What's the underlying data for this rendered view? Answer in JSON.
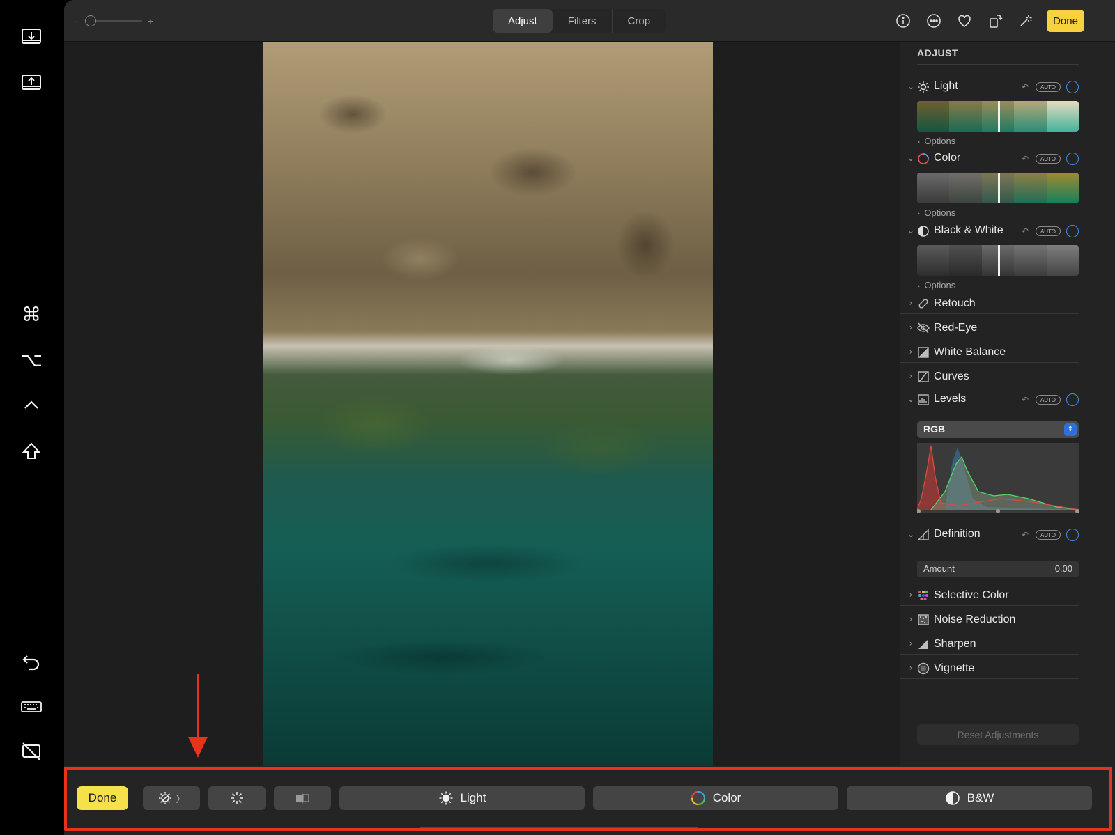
{
  "sidebar": {
    "items": [
      {
        "name": "screenshot-in-icon"
      },
      {
        "name": "screenshot-out-icon"
      },
      {
        "name": "command-key-icon",
        "glyph": "⌘"
      },
      {
        "name": "option-key-icon",
        "glyph": "⌥"
      },
      {
        "name": "control-key-icon",
        "glyph": "^"
      },
      {
        "name": "shift-key-icon",
        "glyph": "⇧"
      },
      {
        "name": "undo-icon"
      },
      {
        "name": "keyboard-icon"
      },
      {
        "name": "hide-screen-icon"
      }
    ]
  },
  "topbar": {
    "zoom": {
      "minus": "-",
      "plus": "+",
      "level": 0.0
    },
    "tabs": [
      {
        "label": "Adjust",
        "active": true
      },
      {
        "label": "Filters",
        "active": false
      },
      {
        "label": "Crop",
        "active": false
      }
    ],
    "icons": [
      "info-icon",
      "more-icon",
      "heart-icon",
      "rotate-icon",
      "magic-wand-icon"
    ],
    "done_label": "Done"
  },
  "panel": {
    "title": "ADJUST",
    "undo_glyph": "↶",
    "auto_label": "AUTO",
    "options_label": "Options",
    "options_chevron": "›",
    "light": {
      "label": "Light",
      "chevron": "⌄"
    },
    "color": {
      "label": "Color",
      "chevron": "⌄"
    },
    "bw": {
      "label": "Black & White",
      "chevron": "⌄"
    },
    "collapsed": [
      {
        "label": "Retouch",
        "icon": "bandage-icon"
      },
      {
        "label": "Red-Eye",
        "icon": "eye-icon"
      },
      {
        "label": "White Balance",
        "icon": "white-balance-icon"
      },
      {
        "label": "Curves",
        "icon": "curves-icon"
      }
    ],
    "levels": {
      "label": "Levels",
      "channel": "RGB",
      "select_arrows": "⇕"
    },
    "definition": {
      "label": "Definition",
      "amount_label": "Amount",
      "amount_value": "0.00"
    },
    "collapsed2": [
      {
        "label": "Selective Color",
        "icon": "selective-color-icon"
      },
      {
        "label": "Noise Reduction",
        "icon": "noise-reduction-icon"
      },
      {
        "label": "Sharpen",
        "icon": "sharpen-icon"
      },
      {
        "label": "Vignette",
        "icon": "vignette-icon"
      }
    ],
    "collapsed_chevron": "›",
    "reset_label": "Reset Adjustments"
  },
  "bottombar": {
    "done_label": "Done",
    "buttons": [
      {
        "name": "auto-enhance-button",
        "icon": "auto-enhance-icon",
        "suffix": "〉"
      },
      {
        "name": "magic-button",
        "icon": "magic-wand-icon"
      },
      {
        "name": "compare-button",
        "icon": "compare-icon"
      },
      {
        "name": "light-button",
        "icon": "sun-icon",
        "label": "Light"
      },
      {
        "name": "color-button",
        "icon": "color-wheel-icon",
        "label": "Color"
      },
      {
        "name": "bw-button",
        "icon": "half-circle-icon",
        "label": "B&W"
      }
    ]
  },
  "colors": {
    "accent_done": "#f7e14a",
    "annotation": "#e8331c",
    "toggle": "#3d8ef7"
  }
}
